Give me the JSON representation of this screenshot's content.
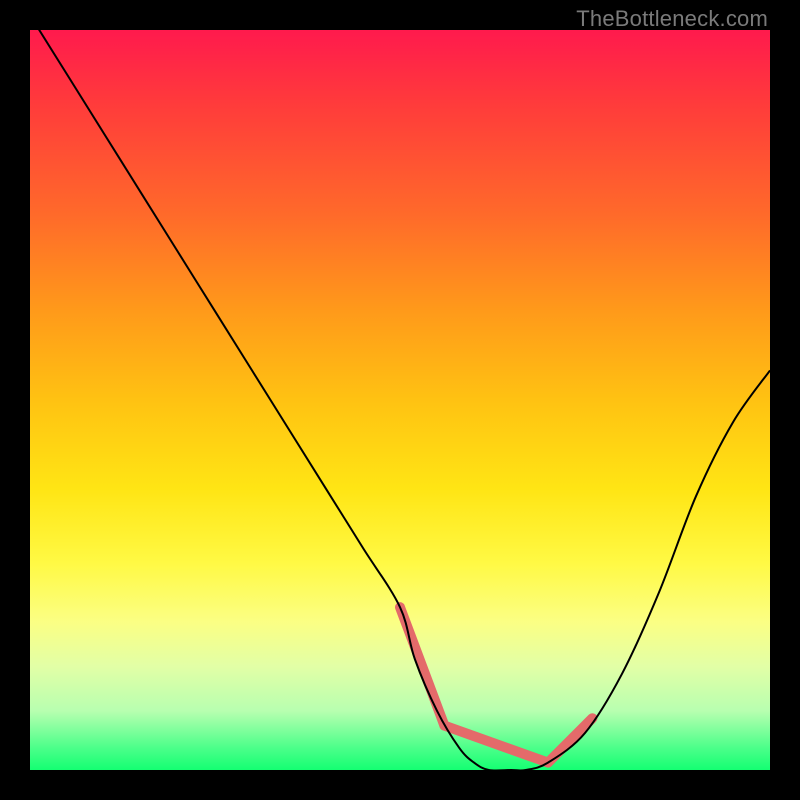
{
  "attribution": "TheBottleneck.com",
  "chart_data": {
    "type": "line",
    "title": "",
    "xlabel": "",
    "ylabel": "",
    "xlim": [
      0,
      100
    ],
    "ylim": [
      0,
      100
    ],
    "x": [
      0,
      5,
      10,
      15,
      20,
      25,
      30,
      35,
      40,
      45,
      50,
      52,
      55,
      58,
      60,
      62,
      65,
      67,
      70,
      75,
      80,
      85,
      90,
      95,
      100
    ],
    "values": [
      102,
      94,
      86,
      78,
      70,
      62,
      54,
      46,
      38,
      30,
      22,
      15,
      8,
      3,
      1,
      0,
      0,
      0,
      1,
      5,
      13,
      24,
      37,
      47,
      54
    ],
    "highlight_segments": [
      {
        "x0": 50,
        "y0": 22,
        "x1": 56,
        "y1": 6,
        "width": 10
      },
      {
        "x0": 56,
        "y0": 6,
        "x1": 70,
        "y1": 1,
        "width": 10
      },
      {
        "x0": 70,
        "y0": 1,
        "x1": 76,
        "y1": 7,
        "width": 10
      }
    ],
    "colors": {
      "curve": "#000000",
      "highlight": "#e46a6a"
    }
  }
}
